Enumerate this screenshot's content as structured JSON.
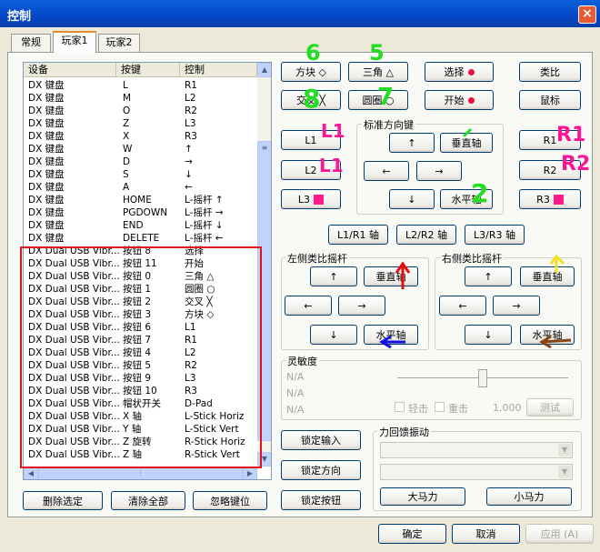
{
  "window": {
    "title": "控制",
    "close": "×"
  },
  "tabs": [
    "常规",
    "玩家1",
    "玩家2"
  ],
  "list": {
    "columns": [
      "设备",
      "按键",
      "控制"
    ],
    "rows": [
      [
        "DX 键盘",
        "L",
        "R1"
      ],
      [
        "DX 键盘",
        "M",
        "L2"
      ],
      [
        "DX 键盘",
        "O",
        "R2"
      ],
      [
        "DX 键盘",
        "Z",
        "L3"
      ],
      [
        "DX 键盘",
        "X",
        "R3"
      ],
      [
        "DX 键盘",
        "W",
        "↑"
      ],
      [
        "DX 键盘",
        "D",
        "→"
      ],
      [
        "DX 键盘",
        "S",
        "↓"
      ],
      [
        "DX 键盘",
        "A",
        "←"
      ],
      [
        "DX 键盘",
        "HOME",
        "L-摇杆 ↑"
      ],
      [
        "DX 键盘",
        "PGDOWN",
        "L-摇杆 →"
      ],
      [
        "DX 键盘",
        "END",
        "L-摇杆 ↓"
      ],
      [
        "DX 键盘",
        "DELETE",
        "L-摇杆 ←"
      ],
      [
        "DX Dual USB Vibr...",
        "按钮 8",
        "选择"
      ],
      [
        "DX Dual USB Vibr...",
        "按钮 11",
        "开始"
      ],
      [
        "DX Dual USB Vibr...",
        "按钮 0",
        "三角 △"
      ],
      [
        "DX Dual USB Vibr...",
        "按钮 1",
        "圆圈 ○"
      ],
      [
        "DX Dual USB Vibr...",
        "按钮 2",
        "交叉 ╳"
      ],
      [
        "DX Dual USB Vibr...",
        "按钮 3",
        "方块 ◇"
      ],
      [
        "DX Dual USB Vibr...",
        "按钮 6",
        "L1"
      ],
      [
        "DX Dual USB Vibr...",
        "按钮 7",
        "R1"
      ],
      [
        "DX Dual USB Vibr...",
        "按钮 4",
        "L2"
      ],
      [
        "DX Dual USB Vibr...",
        "按钮 5",
        "R2"
      ],
      [
        "DX Dual USB Vibr...",
        "按钮 9",
        "L3"
      ],
      [
        "DX Dual USB Vibr...",
        "按钮 10",
        "R3"
      ],
      [
        "DX Dual USB Vibr...",
        "帽状开关",
        "D-Pad"
      ],
      [
        "DX Dual USB Vibr...",
        "X 轴",
        "L-Stick Horiz"
      ],
      [
        "DX Dual USB Vibr...",
        "Y 轴",
        "L-Stick Vert"
      ],
      [
        "DX Dual USB Vibr...",
        "Z 旋转",
        "R-Stick Horiz"
      ],
      [
        "DX Dual USB Vibr...",
        "Z 轴",
        "R-Stick Vert"
      ]
    ]
  },
  "buttons": {
    "square": "方块 ◇",
    "triangle": "三角 △",
    "select": "选择",
    "analog": "类比",
    "cross": "交叉 ╳",
    "circle": "圆圈 ○",
    "start": "开始",
    "mouse": "鼠标",
    "l1": "L1",
    "r1": "R1",
    "l2": "L2",
    "r2": "R2",
    "l3": "L3",
    "r3": "R3",
    "l1r1": "L1/R1 轴",
    "l2r2": "L2/R2 轴",
    "l3r3": "L3/R3 轴",
    "up": "↑",
    "down": "↓",
    "left": "←",
    "right": "→",
    "vertical": "垂直轴",
    "horizontal": "水平轴",
    "lock_input": "锁定输入",
    "lock_dir": "锁定方向",
    "lock_btn": "锁定按钮",
    "big_motor": "大马力",
    "small_motor": "小马力",
    "test": "测试",
    "delete_sel": "删除选定",
    "clear_all": "清除全部",
    "ignore_key": "忽略键位",
    "ok": "确定",
    "cancel": "取消",
    "apply": "应用 (A)"
  },
  "groups": {
    "dpad": "标准方向键",
    "left_stick": "左侧类比摇杆",
    "right_stick": "右侧类比摇杆",
    "sensitivity": "灵敏度",
    "force_feedback": "力回馈振动"
  },
  "sensitivity": {
    "na1": "N/A",
    "na2": "N/A",
    "na3": "N/A",
    "light": "轻击",
    "heavy": "重击",
    "value": "1.000",
    "slider_level": 0.5
  },
  "annotations": [
    "6",
    "5",
    "8",
    "7",
    "L1",
    "R1",
    "L1",
    "R2",
    "2"
  ],
  "colors": {
    "title_bar": "#0a5fd8",
    "highlight_box": "#e0101c",
    "green_anno": "#22dd22",
    "pink_anno": "#ff1493",
    "red_arrow": "#e01010",
    "blue_arrow": "#1010e0",
    "yellow_arrow": "#f0e020",
    "brown_arrow": "#8b4513"
  }
}
